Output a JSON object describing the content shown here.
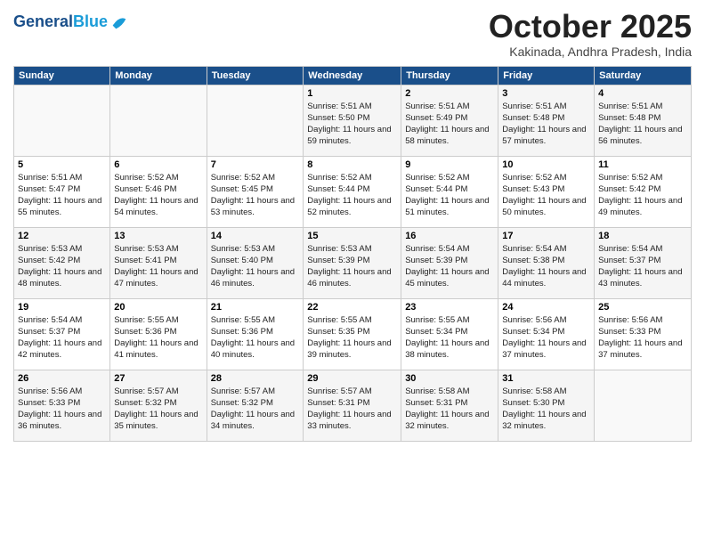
{
  "header": {
    "title": "October 2025",
    "subtitle": "Kakinada, Andhra Pradesh, India"
  },
  "calendar": {
    "days": [
      "Sunday",
      "Monday",
      "Tuesday",
      "Wednesday",
      "Thursday",
      "Friday",
      "Saturday"
    ]
  },
  "weeks": [
    [
      {
        "day": "",
        "info": ""
      },
      {
        "day": "",
        "info": ""
      },
      {
        "day": "",
        "info": ""
      },
      {
        "day": "1",
        "info": "Sunrise: 5:51 AM\nSunset: 5:50 PM\nDaylight: 11 hours\nand 59 minutes."
      },
      {
        "day": "2",
        "info": "Sunrise: 5:51 AM\nSunset: 5:49 PM\nDaylight: 11 hours\nand 58 minutes."
      },
      {
        "day": "3",
        "info": "Sunrise: 5:51 AM\nSunset: 5:48 PM\nDaylight: 11 hours\nand 57 minutes."
      },
      {
        "day": "4",
        "info": "Sunrise: 5:51 AM\nSunset: 5:48 PM\nDaylight: 11 hours\nand 56 minutes."
      }
    ],
    [
      {
        "day": "5",
        "info": "Sunrise: 5:51 AM\nSunset: 5:47 PM\nDaylight: 11 hours\nand 55 minutes."
      },
      {
        "day": "6",
        "info": "Sunrise: 5:52 AM\nSunset: 5:46 PM\nDaylight: 11 hours\nand 54 minutes."
      },
      {
        "day": "7",
        "info": "Sunrise: 5:52 AM\nSunset: 5:45 PM\nDaylight: 11 hours\nand 53 minutes."
      },
      {
        "day": "8",
        "info": "Sunrise: 5:52 AM\nSunset: 5:44 PM\nDaylight: 11 hours\nand 52 minutes."
      },
      {
        "day": "9",
        "info": "Sunrise: 5:52 AM\nSunset: 5:44 PM\nDaylight: 11 hours\nand 51 minutes."
      },
      {
        "day": "10",
        "info": "Sunrise: 5:52 AM\nSunset: 5:43 PM\nDaylight: 11 hours\nand 50 minutes."
      },
      {
        "day": "11",
        "info": "Sunrise: 5:52 AM\nSunset: 5:42 PM\nDaylight: 11 hours\nand 49 minutes."
      }
    ],
    [
      {
        "day": "12",
        "info": "Sunrise: 5:53 AM\nSunset: 5:42 PM\nDaylight: 11 hours\nand 48 minutes."
      },
      {
        "day": "13",
        "info": "Sunrise: 5:53 AM\nSunset: 5:41 PM\nDaylight: 11 hours\nand 47 minutes."
      },
      {
        "day": "14",
        "info": "Sunrise: 5:53 AM\nSunset: 5:40 PM\nDaylight: 11 hours\nand 46 minutes."
      },
      {
        "day": "15",
        "info": "Sunrise: 5:53 AM\nSunset: 5:39 PM\nDaylight: 11 hours\nand 46 minutes."
      },
      {
        "day": "16",
        "info": "Sunrise: 5:54 AM\nSunset: 5:39 PM\nDaylight: 11 hours\nand 45 minutes."
      },
      {
        "day": "17",
        "info": "Sunrise: 5:54 AM\nSunset: 5:38 PM\nDaylight: 11 hours\nand 44 minutes."
      },
      {
        "day": "18",
        "info": "Sunrise: 5:54 AM\nSunset: 5:37 PM\nDaylight: 11 hours\nand 43 minutes."
      }
    ],
    [
      {
        "day": "19",
        "info": "Sunrise: 5:54 AM\nSunset: 5:37 PM\nDaylight: 11 hours\nand 42 minutes."
      },
      {
        "day": "20",
        "info": "Sunrise: 5:55 AM\nSunset: 5:36 PM\nDaylight: 11 hours\nand 41 minutes."
      },
      {
        "day": "21",
        "info": "Sunrise: 5:55 AM\nSunset: 5:36 PM\nDaylight: 11 hours\nand 40 minutes."
      },
      {
        "day": "22",
        "info": "Sunrise: 5:55 AM\nSunset: 5:35 PM\nDaylight: 11 hours\nand 39 minutes."
      },
      {
        "day": "23",
        "info": "Sunrise: 5:55 AM\nSunset: 5:34 PM\nDaylight: 11 hours\nand 38 minutes."
      },
      {
        "day": "24",
        "info": "Sunrise: 5:56 AM\nSunset: 5:34 PM\nDaylight: 11 hours\nand 37 minutes."
      },
      {
        "day": "25",
        "info": "Sunrise: 5:56 AM\nSunset: 5:33 PM\nDaylight: 11 hours\nand 37 minutes."
      }
    ],
    [
      {
        "day": "26",
        "info": "Sunrise: 5:56 AM\nSunset: 5:33 PM\nDaylight: 11 hours\nand 36 minutes."
      },
      {
        "day": "27",
        "info": "Sunrise: 5:57 AM\nSunset: 5:32 PM\nDaylight: 11 hours\nand 35 minutes."
      },
      {
        "day": "28",
        "info": "Sunrise: 5:57 AM\nSunset: 5:32 PM\nDaylight: 11 hours\nand 34 minutes."
      },
      {
        "day": "29",
        "info": "Sunrise: 5:57 AM\nSunset: 5:31 PM\nDaylight: 11 hours\nand 33 minutes."
      },
      {
        "day": "30",
        "info": "Sunrise: 5:58 AM\nSunset: 5:31 PM\nDaylight: 11 hours\nand 32 minutes."
      },
      {
        "day": "31",
        "info": "Sunrise: 5:58 AM\nSunset: 5:30 PM\nDaylight: 11 hours\nand 32 minutes."
      },
      {
        "day": "",
        "info": ""
      }
    ]
  ]
}
